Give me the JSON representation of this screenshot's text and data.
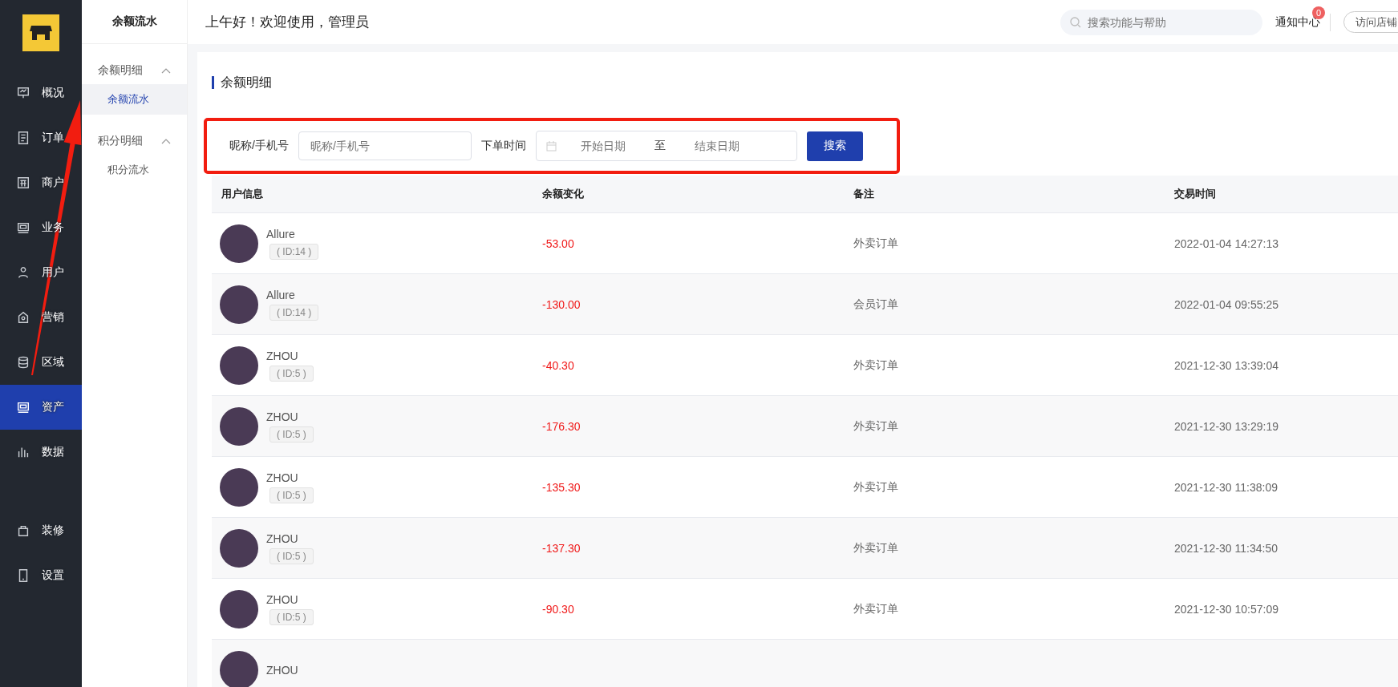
{
  "nav": {
    "items": [
      {
        "label": "概况",
        "selected": false
      },
      {
        "label": "订单",
        "selected": false
      },
      {
        "label": "商户",
        "selected": false
      },
      {
        "label": "业务",
        "selected": false
      },
      {
        "label": "用户",
        "selected": false
      },
      {
        "label": "营销",
        "selected": false
      },
      {
        "label": "区域",
        "selected": false
      },
      {
        "label": "资产",
        "selected": true
      },
      {
        "label": "数据",
        "selected": false
      }
    ],
    "bottom_items": [
      {
        "label": "装修",
        "selected": false
      },
      {
        "label": "设置",
        "selected": false
      }
    ]
  },
  "subnav": {
    "title": "余额流水",
    "groups": [
      {
        "label": "余额明细",
        "expanded": true,
        "children": [
          {
            "label": "余额流水",
            "selected": true
          }
        ]
      },
      {
        "label": "积分明细",
        "expanded": true,
        "children": [
          {
            "label": "积分流水",
            "selected": false
          }
        ]
      }
    ]
  },
  "header": {
    "greeting": "上午好！欢迎使用，管理员",
    "search": {
      "placeholder": "搜索功能与帮助"
    },
    "notifications": {
      "label": "通知中心",
      "badge": "0"
    },
    "visit_button": "访问店铺"
  },
  "page": {
    "title": "余额明细"
  },
  "filter": {
    "name_label": "昵称/手机号",
    "name_placeholder": "昵称/手机号",
    "date_label": "下单时间",
    "start_placeholder": "开始日期",
    "separator": "至",
    "end_placeholder": "结束日期",
    "search_button": "搜索"
  },
  "table": {
    "columns": [
      "用户信息",
      "余额变化",
      "备注",
      "交易时间"
    ],
    "rows": [
      {
        "name": "Allure",
        "id": "( ID:14 )",
        "change": "-53.00",
        "note": "外卖订单",
        "time": "2022-01-04 14:27:13"
      },
      {
        "name": "Allure",
        "id": "( ID:14 )",
        "change": "-130.00",
        "note": "会员订单",
        "time": "2022-01-04 09:55:25"
      },
      {
        "name": "ZHOU",
        "id": "( ID:5 )",
        "change": "-40.30",
        "note": "外卖订单",
        "time": "2021-12-30 13:39:04"
      },
      {
        "name": "ZHOU",
        "id": "( ID:5 )",
        "change": "-176.30",
        "note": "外卖订单",
        "time": "2021-12-30 13:29:19"
      },
      {
        "name": "ZHOU",
        "id": "( ID:5 )",
        "change": "-135.30",
        "note": "外卖订单",
        "time": "2021-12-30 11:38:09"
      },
      {
        "name": "ZHOU",
        "id": "( ID:5 )",
        "change": "-137.30",
        "note": "外卖订单",
        "time": "2021-12-30 11:34:50"
      },
      {
        "name": "ZHOU",
        "id": "( ID:5 )",
        "change": "-90.30",
        "note": "外卖订单",
        "time": "2021-12-30 10:57:09"
      },
      {
        "name": "ZHOU"
      }
    ]
  }
}
